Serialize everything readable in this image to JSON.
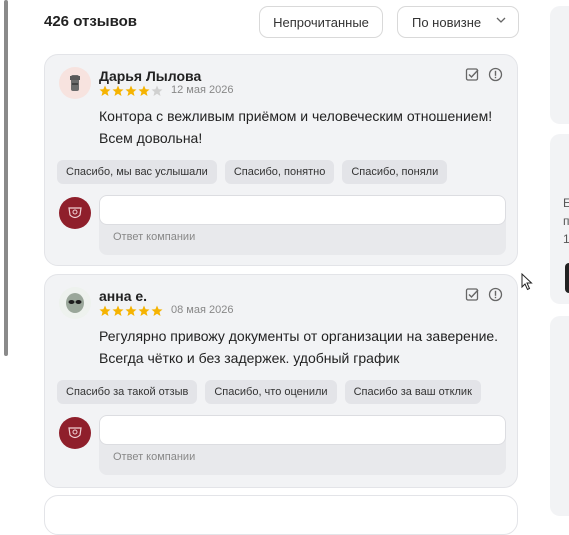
{
  "header": {
    "review_count": "426 отзывов",
    "filter_unread": "Непрочитанные",
    "sort_selected": "По новизне"
  },
  "reviews": [
    {
      "author": "Дарья Лылова",
      "date": "12 мая 2026",
      "rating": 4,
      "rating_max": 5,
      "text": "Контора с вежливым приёмом и человеческим отношением! Всем довольна!",
      "quick_replies": [
        "Спасибо, мы вас услышали",
        "Спасибо, понятно",
        "Спасибо, поняли"
      ],
      "reply_placeholder": "Ответ компании"
    },
    {
      "author": "анна е.",
      "date": "08 мая 2026",
      "rating": 5,
      "rating_max": 5,
      "text": "Регулярно привожу документы от организации на заверение. Всегда чётко и без задержек. удобный график",
      "quick_replies": [
        "Спасибо за такой отзыв",
        "Спасибо, что оценили",
        "Спасибо за ваш отклик"
      ],
      "reply_placeholder": "Ответ компании"
    }
  ],
  "right_panel": {
    "letters": [
      "Е",
      "п",
      "1"
    ]
  },
  "colors": {
    "star": "#f5b301",
    "star_empty": "#d0d0d0",
    "company_logo": "#8f1f2b",
    "card_bg": "#f2f3f5"
  },
  "icons": [
    "sort-chevron-icon",
    "mark-read-icon",
    "report-icon",
    "cursor-icon"
  ]
}
